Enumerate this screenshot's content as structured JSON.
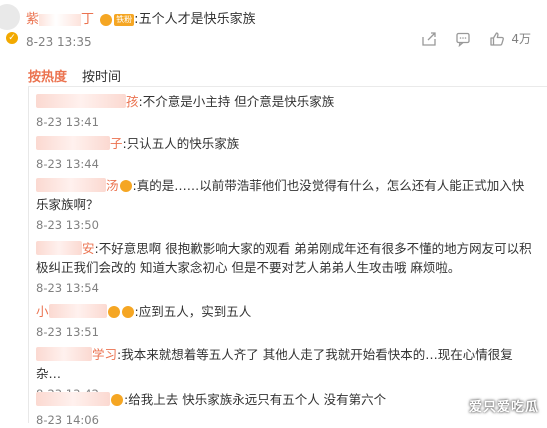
{
  "post": {
    "username_visible": "紫",
    "username_tail": "丁",
    "badge_tag": "铁粉",
    "text": "五个人才是快乐家族",
    "time": "8-23 13:35",
    "like_count": "4万"
  },
  "tabs": {
    "hot": "按热度",
    "time": "按时间"
  },
  "comments": [
    {
      "author": "今...孩",
      "author_tail": "孩",
      "text": "不介意是小主持 但介意是快乐家族",
      "time": "8-23 13:41",
      "badge": false
    },
    {
      "author": "偶...子",
      "author_tail": "子",
      "text": "只认五人的快乐家族",
      "time": "8-23 13:44",
      "badge": false
    },
    {
      "author": "汤",
      "author_tail": "汤",
      "text": "真的是……以前带浩菲他们也没觉得有什么，怎么还有人能正式加入快乐家族啊？",
      "time": "8-23 13:50",
      "badge": true
    },
    {
      "author": "阿...安",
      "author_tail": "安",
      "text": "不好意思啊 很抱歉影响大家的观看 弟弟刚成年还有很多不懂的地方网友可以积极纠正我们会改的 知道大家念初心 但是不要对艺人弟弟人生攻击哦 麻烦啦。",
      "time": "8-23 13:54",
      "badge": false
    },
    {
      "author": "小",
      "author_tail": "",
      "text": "应到五人，实到五人",
      "time": "8-23 13:51",
      "badge": true
    },
    {
      "author": "麻...学习",
      "author_tail": "学习",
      "text": "我本来就想着等五人齐了 其他人走了我就开始看快本的…现在心情很复杂…",
      "time": "8-23 13:42",
      "badge": false
    },
    {
      "author": "",
      "author_tail": "",
      "text": "给我上去 快乐家族永远只有五个人 没有第六个",
      "time": "8-23 14:06",
      "badge": true
    }
  ],
  "watermark": "爱只爱吃瓜"
}
